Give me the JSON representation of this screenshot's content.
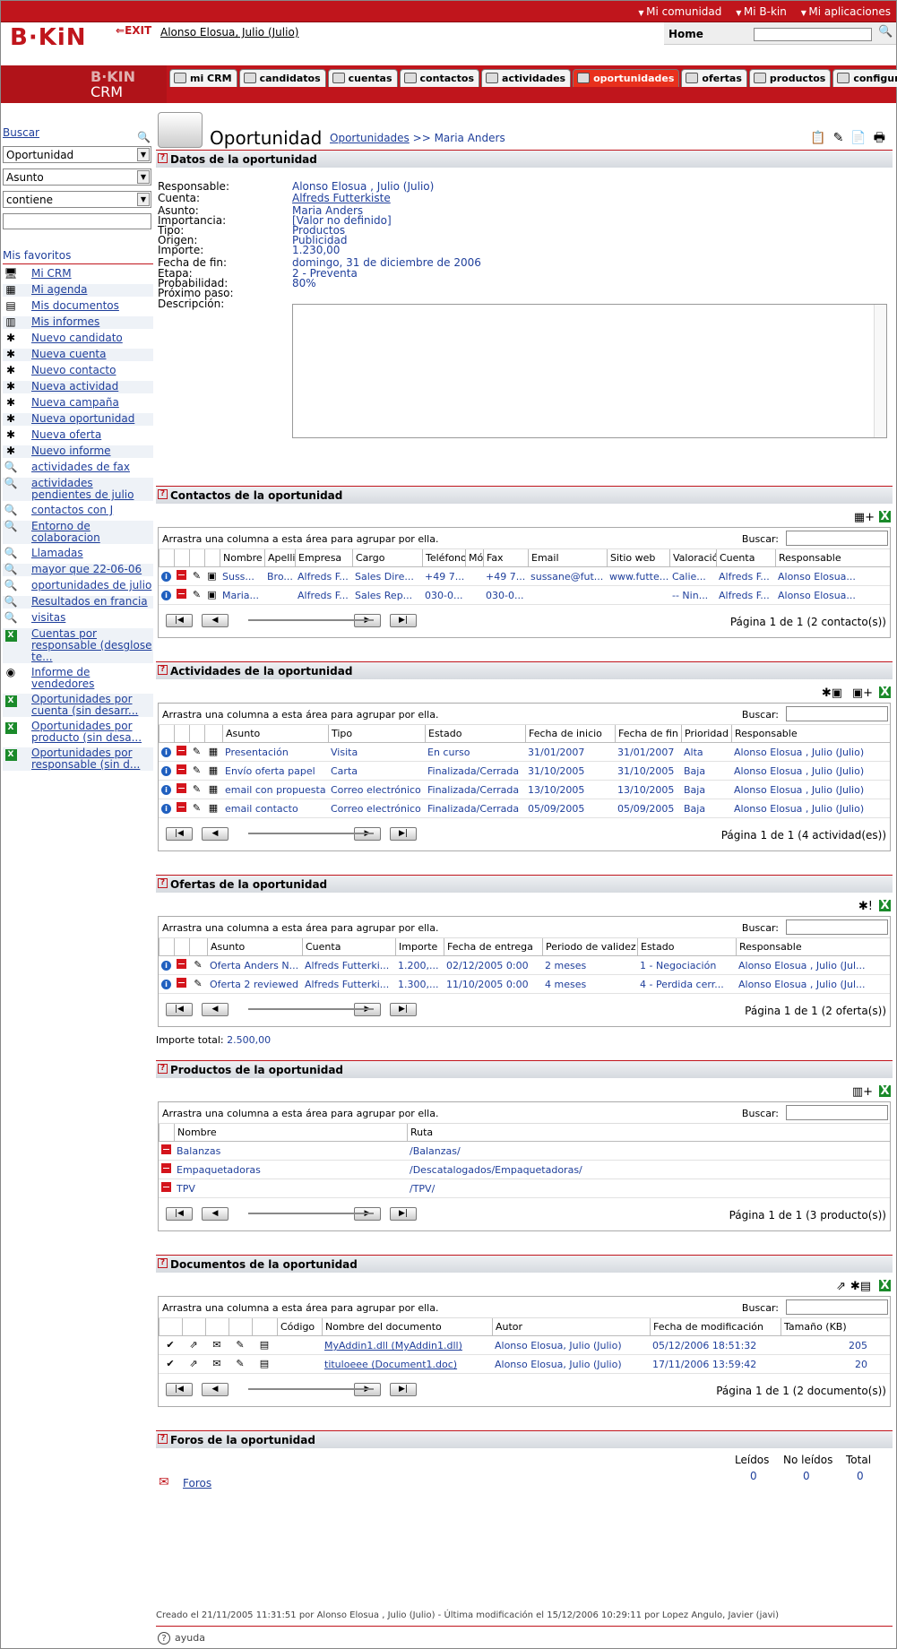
{
  "header": {
    "top_links": [
      "Mi comunidad",
      "Mi B-kin",
      "Mi aplicaciones"
    ],
    "logo": "B·KiN",
    "exit": "EXIT",
    "user": "Alonso Elosua, Julio (Julio)",
    "home": "Home",
    "crm_brand": "B·KIN",
    "crm_label": "CRM"
  },
  "tabs": [
    "mi CRM",
    "candidatos",
    "cuentas",
    "contactos",
    "actividades",
    "oportunidades",
    "ofertas",
    "productos",
    "configuración"
  ],
  "active_tab": "oportunidades",
  "sidebar": {
    "buscar": "Buscar",
    "select1": "Oportunidad",
    "select2": "Asunto",
    "select3": "contiene",
    "favs_title": "Mis favoritos",
    "favs": [
      {
        "label": "Mi CRM",
        "icon": "monitor-icon"
      },
      {
        "label": "Mi agenda",
        "icon": "calendar-icon"
      },
      {
        "label": "Mis documentos",
        "icon": "documents-icon"
      },
      {
        "label": "Mis informes",
        "icon": "report-icon"
      },
      {
        "label": "Nuevo candidato",
        "icon": "new-candidate-icon"
      },
      {
        "label": "Nueva cuenta",
        "icon": "new-account-icon"
      },
      {
        "label": "Nuevo contacto",
        "icon": "new-contact-icon"
      },
      {
        "label": "Nueva actividad",
        "icon": "new-activity-icon"
      },
      {
        "label": "Nueva campaña",
        "icon": "new-campaign-icon"
      },
      {
        "label": "Nueva oportunidad",
        "icon": "new-opportunity-icon"
      },
      {
        "label": "Nueva oferta",
        "icon": "new-offer-icon"
      },
      {
        "label": "Nuevo informe",
        "icon": "new-report-icon"
      },
      {
        "label": "actividades de fax",
        "icon": "search-icon"
      },
      {
        "label": "actividades pendientes de julio",
        "icon": "search-icon"
      },
      {
        "label": "contactos con J",
        "icon": "search-icon"
      },
      {
        "label": "Entorno de colaboracion",
        "icon": "search-icon"
      },
      {
        "label": "Llamadas",
        "icon": "search-icon"
      },
      {
        "label": "mayor que 22-06-06",
        "icon": "search-icon"
      },
      {
        "label": "oportunidades de julio",
        "icon": "search-icon"
      },
      {
        "label": "Resultados en francia",
        "icon": "search-icon"
      },
      {
        "label": "visitas",
        "icon": "search-icon"
      },
      {
        "label": "Cuentas por responsable (desglose te...",
        "icon": "excel-icon"
      },
      {
        "label": "Informe de vendedores",
        "icon": "globe-icon"
      },
      {
        "label": "Oportunidades por cuenta (sin desarr...",
        "icon": "excel-icon"
      },
      {
        "label": "Oportunidades por producto (sin desa...",
        "icon": "excel-icon"
      },
      {
        "label": "Oportunidades por responsable (sin d...",
        "icon": "excel-icon"
      }
    ]
  },
  "page": {
    "title": "Oportunidad",
    "breadcrumb_link": "Oportunidades",
    "breadcrumb_rest": ">> Maria Anders"
  },
  "datos": {
    "title": "Datos de la oportunidad",
    "labels": [
      "Responsable:",
      "Cuenta:",
      "Asunto:",
      "Importancia:",
      "Tipo:",
      "Origen:",
      "Importe:",
      "Fecha de fin:",
      "Etapa:",
      "Probabilidad:",
      "Próximo paso:",
      "Descripción:"
    ],
    "values": [
      "Alonso Elosua , Julio (Julio)",
      "Alfreds Futterkiste",
      "Maria Anders",
      "[Valor no definido]",
      "Productos",
      "Publicidad",
      "1.230,00",
      "domingo, 31 de diciembre de 2006",
      "2 - Preventa",
      "80%",
      "",
      ""
    ]
  },
  "common": {
    "drag": "Arrastra una columna a esta área para agrupar por ella.",
    "buscar": "Buscar:"
  },
  "contactos": {
    "title": "Contactos de la oportunidad",
    "headers": [
      "Nombre",
      "Apellido",
      "Empresa",
      "Cargo",
      "Teléfono",
      "Mó",
      "Fax",
      "Email",
      "Sitio web",
      "Valoración",
      "Cuenta",
      "Responsable"
    ],
    "rows": [
      [
        "Suss...",
        "Bro...",
        "Alfreds F...",
        "Sales Dire...",
        "+49 7...",
        "",
        "+49 7...",
        "sussane@fut...",
        "www.futte...",
        "Calie...",
        "Alfreds F...",
        "Alonso Elosua..."
      ],
      [
        "Maria...",
        "",
        "Alfreds F...",
        "Sales Rep...",
        "030-0...",
        "",
        "030-0...",
        "",
        "",
        "-- Nin...",
        "Alfreds F...",
        "Alonso Elosua..."
      ]
    ],
    "pager": "Página 1 de 1 (2 contacto(s))"
  },
  "actividades": {
    "title": "Actividades de la oportunidad",
    "headers": [
      "Asunto",
      "Tipo",
      "Estado",
      "Fecha de inicio",
      "Fecha de fin",
      "Prioridad",
      "Responsable"
    ],
    "rows": [
      [
        "Presentación",
        "Visita",
        "En curso",
        "31/01/2007",
        "31/01/2007",
        "Alta",
        "Alonso Elosua , Julio (Julio)"
      ],
      [
        "Envío oferta papel",
        "Carta",
        "Finalizada/Cerrada",
        "31/10/2005",
        "31/10/2005",
        "Baja",
        "Alonso Elosua , Julio (Julio)"
      ],
      [
        "email con propuesta",
        "Correo electrónico",
        "Finalizada/Cerrada",
        "13/10/2005",
        "13/10/2005",
        "Baja",
        "Alonso Elosua , Julio (Julio)"
      ],
      [
        "email contacto",
        "Correo electrónico",
        "Finalizada/Cerrada",
        "05/09/2005",
        "05/09/2005",
        "Baja",
        "Alonso Elosua , Julio (Julio)"
      ]
    ],
    "pager": "Página 1 de 1 (4 actividad(es))"
  },
  "ofertas": {
    "title": "Ofertas de la oportunidad",
    "headers": [
      "Asunto",
      "Cuenta",
      "Importe",
      "Fecha de entrega",
      "Periodo de validez",
      "Estado",
      "Responsable"
    ],
    "rows": [
      [
        "Oferta Anders N...",
        "Alfreds Futterki...",
        "1.200,...",
        "02/12/2005 0:00",
        "2 meses",
        "1 - Negociación",
        "Alonso Elosua , Julio (Jul..."
      ],
      [
        "Oferta 2 reviewed",
        "Alfreds Futterki...",
        "1.300,...",
        "11/10/2005 0:00",
        "4 meses",
        "4 - Perdida cerr...",
        "Alonso Elosua , Julio (Jul..."
      ]
    ],
    "pager": "Página 1 de 1 (2 oferta(s))",
    "total_label": "Importe total:",
    "total_value": "2.500,00"
  },
  "productos": {
    "title": "Productos de la oportunidad",
    "headers": [
      "Nombre",
      "Ruta"
    ],
    "rows": [
      [
        "Balanzas",
        "/Balanzas/"
      ],
      [
        "Empaquetadoras",
        "/Descatalogados/Empaquetadoras/"
      ],
      [
        "TPV",
        "/TPV/"
      ]
    ],
    "pager": "Página 1 de 1 (3 producto(s))"
  },
  "documentos": {
    "title": "Documentos de la oportunidad",
    "headers": [
      "Código",
      "Nombre del documento",
      "Autor",
      "Fecha de modificación",
      "Tamaño (KB)"
    ],
    "rows": [
      [
        "",
        "MyAddin1.dll (MyAddin1.dll)",
        "Alonso Elosua, Julio (Julio)",
        "05/12/2006 18:51:32",
        "205"
      ],
      [
        "",
        "tituloeee (Document1.doc)",
        "Alonso Elosua, Julio (Julio)",
        "17/11/2006 13:59:42",
        "20"
      ]
    ],
    "pager": "Página 1 de 1 (2 documento(s))"
  },
  "foros": {
    "title": "Foros de la oportunidad",
    "link": "Foros",
    "headers": [
      "Leídos",
      "No leídos",
      "Total"
    ],
    "values": [
      "0",
      "0",
      "0"
    ]
  },
  "footer": {
    "created": "Creado el 21/11/2005 11:31:51 por Alonso Elosua , Julio (Julio) - Última modificación el 15/12/2006 10:29:11 por Lopez Angulo, Javier (javi)",
    "help": "ayuda"
  },
  "colors": {
    "brand_red": "#c0151c",
    "link_blue": "#1f3f9b",
    "active_tab": "#e8301d"
  }
}
